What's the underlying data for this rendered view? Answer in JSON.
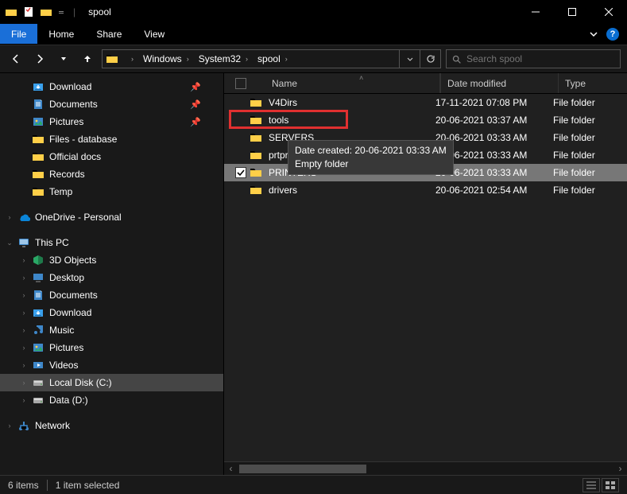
{
  "titlebar": {
    "title": "spool"
  },
  "ribbon": {
    "file": "File",
    "tabs": [
      "Home",
      "Share",
      "View"
    ]
  },
  "address": {
    "crumbs": [
      "Windows",
      "System32",
      "spool"
    ]
  },
  "search": {
    "placeholder": "Search spool"
  },
  "sidebar": {
    "quick": [
      {
        "label": "Download",
        "pin": true,
        "icon": "download"
      },
      {
        "label": "Documents",
        "pin": true,
        "icon": "documents"
      },
      {
        "label": "Pictures",
        "pin": true,
        "icon": "pictures"
      },
      {
        "label": "Files - database",
        "pin": false,
        "icon": "folder"
      },
      {
        "label": "Official docs",
        "pin": false,
        "icon": "folder"
      },
      {
        "label": "Records",
        "pin": false,
        "icon": "folder"
      },
      {
        "label": "Temp",
        "pin": false,
        "icon": "folder"
      }
    ],
    "onedrive": {
      "label": "OneDrive - Personal"
    },
    "thispc": {
      "label": "This PC",
      "children": [
        {
          "label": "3D Objects",
          "icon": "3d"
        },
        {
          "label": "Desktop",
          "icon": "desktop"
        },
        {
          "label": "Documents",
          "icon": "documents"
        },
        {
          "label": "Download",
          "icon": "download"
        },
        {
          "label": "Music",
          "icon": "music"
        },
        {
          "label": "Pictures",
          "icon": "pictures"
        },
        {
          "label": "Videos",
          "icon": "videos"
        },
        {
          "label": "Local Disk (C:)",
          "icon": "disk"
        },
        {
          "label": "Data (D:)",
          "icon": "disk"
        }
      ]
    },
    "network": {
      "label": "Network"
    }
  },
  "columns": {
    "name": "Name",
    "date": "Date modified",
    "type": "Type"
  },
  "rows": [
    {
      "name": "drivers",
      "date": "20-06-2021 02:54 AM",
      "type": "File folder"
    },
    {
      "name": "PRINTERS",
      "date": "20-06-2021 03:33 AM",
      "type": "File folder"
    },
    {
      "name": "prtprocs",
      "date": "20-06-2021 03:33 AM",
      "type": "File folder"
    },
    {
      "name": "SERVERS",
      "date": "20-06-2021 03:33 AM",
      "type": "File folder"
    },
    {
      "name": "tools",
      "date": "20-06-2021 03:37 AM",
      "type": "File folder"
    },
    {
      "name": "V4Dirs",
      "date": "17-11-2021 07:08 PM",
      "type": "File folder"
    }
  ],
  "selected_row": 1,
  "tooltip": {
    "line1": "Date created: 20-06-2021 03:33 AM",
    "line2": "Empty folder"
  },
  "status": {
    "count": "6 items",
    "selected": "1 item selected"
  }
}
